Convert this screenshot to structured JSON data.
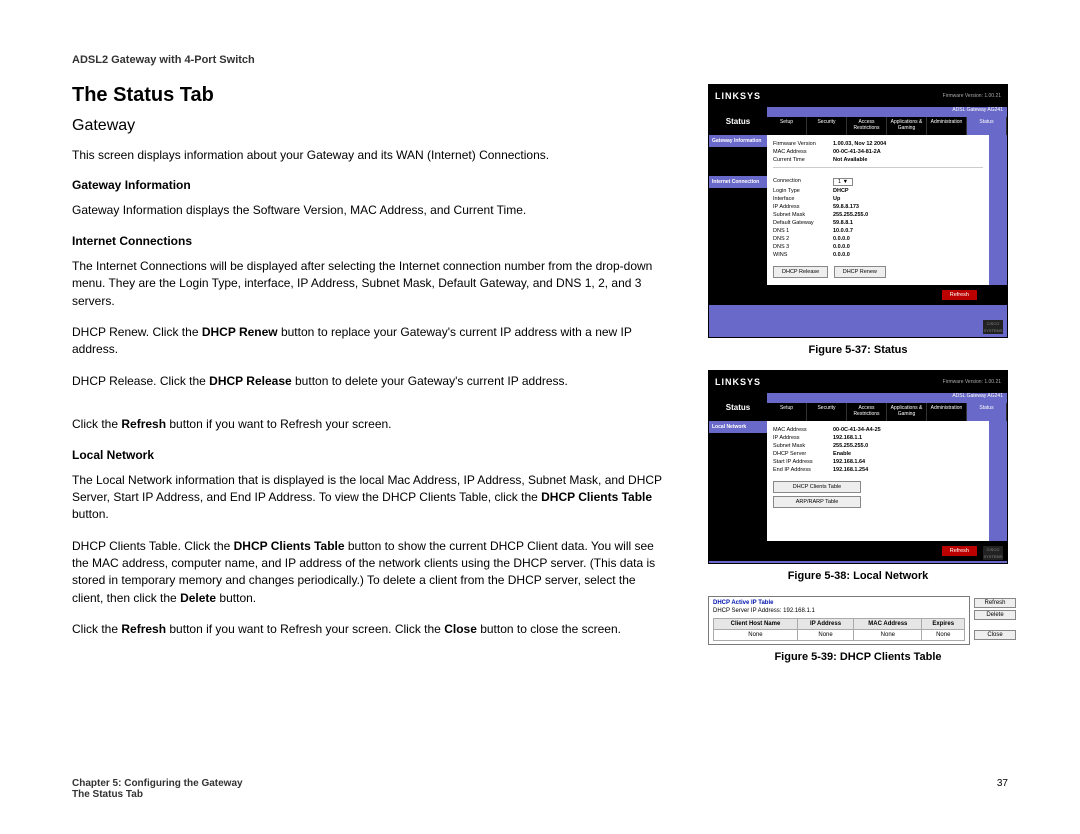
{
  "doc_header": "ADSL2 Gateway with 4-Port Switch",
  "title": "The Status Tab",
  "subtitle": "Gateway",
  "intro": "This screen displays information about your Gateway and its WAN (Internet) Connections.",
  "sections": {
    "gw_info": {
      "heading": "Gateway Information",
      "body": "Gateway Information displays the Software Version, MAC Address, and Current Time."
    },
    "ic": {
      "heading": "Internet Connections",
      "body1": "The Internet Connections will be displayed after selecting the Internet connection number from the drop-down menu. They are the Login Type, interface, IP Address, Subnet Mask, Default Gateway, and DNS 1, 2, and 3 servers.",
      "body2_a": "DHCP Renew. Click the ",
      "body2_b": "DHCP Renew",
      "body2_c": " button to replace your Gateway's current IP address with a new IP address.",
      "body3_a": "DHCP Release. Click the ",
      "body3_b": "DHCP Release",
      "body3_c": " button to delete your Gateway's current IP address.",
      "body4_a": "Click the ",
      "body4_b": "Refresh",
      "body4_c": " button if you want to Refresh your screen."
    },
    "ln": {
      "heading": "Local Network",
      "body1_a": "The Local Network information that is displayed is the local Mac Address, IP Address, Subnet Mask, and DHCP Server, Start IP Address, and End IP Address. To view the DHCP Clients Table, click the ",
      "body1_b": "DHCP Clients Table",
      "body1_c": " button.",
      "body2_a": "DHCP Clients Table. Click the ",
      "body2_b": "DHCP Clients Table",
      "body2_c": " button to show the current DHCP Client data. You will see the MAC address, computer name, and IP address of the network clients using the DHCP server. (This data is stored in temporary memory and changes periodically.) To delete a client from the DHCP server, select the client, then click the ",
      "body2_d": "Delete",
      "body2_e": " button.",
      "body3_a": "Click the ",
      "body3_b": "Refresh",
      "body3_c": " button if you want to Refresh your screen. Click the ",
      "body3_d": "Close",
      "body3_e": " button to close the screen."
    }
  },
  "figures": {
    "f37": {
      "caption": "Figure 5-37: Status",
      "brand": "LINKSYS",
      "fv": "Firmware Version: 1.00.21",
      "model": "ADSL Gateway    AG241",
      "status_label": "Status",
      "tabs": [
        "Setup",
        "Security",
        "Access Restrictions",
        "Applications & Gaming",
        "Administration",
        "Status"
      ],
      "side1": "Gateway Information",
      "side2": "Internet Connection",
      "kv1": [
        {
          "k": "Firmware Version",
          "v": "1.00.03, Nov 12 2004"
        },
        {
          "k": "MAC Address",
          "v": "00-0C-41-34-81-2A"
        },
        {
          "k": "Current Time",
          "v": "Not Available"
        }
      ],
      "kv2": [
        {
          "k": "Connection",
          "v": "1 ▼"
        },
        {
          "k": "Login Type",
          "v": "DHCP"
        },
        {
          "k": "Interface",
          "v": "Up"
        },
        {
          "k": "IP Address",
          "v": "59.8.8.173"
        },
        {
          "k": "Subnet Mask",
          "v": "255.255.255.0"
        },
        {
          "k": "Default Gateway",
          "v": "59.8.8.1"
        },
        {
          "k": "DNS 1",
          "v": "10.0.0.7"
        },
        {
          "k": "DNS 2",
          "v": "0.0.0.0"
        },
        {
          "k": "DNS 3",
          "v": "0.0.0.0"
        },
        {
          "k": "WINS",
          "v": "0.0.0.0"
        }
      ],
      "btn_release": "DHCP Release",
      "btn_renew": "DHCP Renew",
      "btn_refresh": "Refresh"
    },
    "f38": {
      "caption": "Figure 5-38: Local Network",
      "brand": "LINKSYS",
      "fv": "Firmware Version: 1.00.21",
      "model": "ADSL Gateway    AG241",
      "status_label": "Status",
      "tabs": [
        "Setup",
        "Security",
        "Access Restrictions",
        "Applications & Gaming",
        "Administration",
        "Status"
      ],
      "side1": "Local Network",
      "kv": [
        {
          "k": "MAC Address",
          "v": "00-0C-41-34-A4-25"
        },
        {
          "k": "IP Address",
          "v": "192.168.1.1"
        },
        {
          "k": "Subnet Mask",
          "v": "255.255.255.0"
        },
        {
          "k": "DHCP Server",
          "v": "Enable"
        },
        {
          "k": "Start IP Address",
          "v": "192.168.1.64"
        },
        {
          "k": "End IP Address",
          "v": "192.168.1.254"
        }
      ],
      "btn1": "DHCP Clients Table",
      "btn2": "ARP/RARP Table",
      "btn_refresh": "Refresh"
    },
    "f39": {
      "caption": "Figure 5-39: DHCP Clients Table",
      "title": "DHCP Active IP Table",
      "sub": "DHCP Server IP Address:   192.168.1.1",
      "headers": [
        "Client Host Name",
        "IP Address",
        "MAC Address",
        "Expires"
      ],
      "row": [
        "None",
        "None",
        "None",
        "None"
      ],
      "btn_refresh": "Refresh",
      "btn_delete": "Delete",
      "btn_close": "Close"
    }
  },
  "footer": {
    "chapter": "Chapter 5: Configuring the Gateway",
    "section": "The Status Tab",
    "page": "37"
  }
}
